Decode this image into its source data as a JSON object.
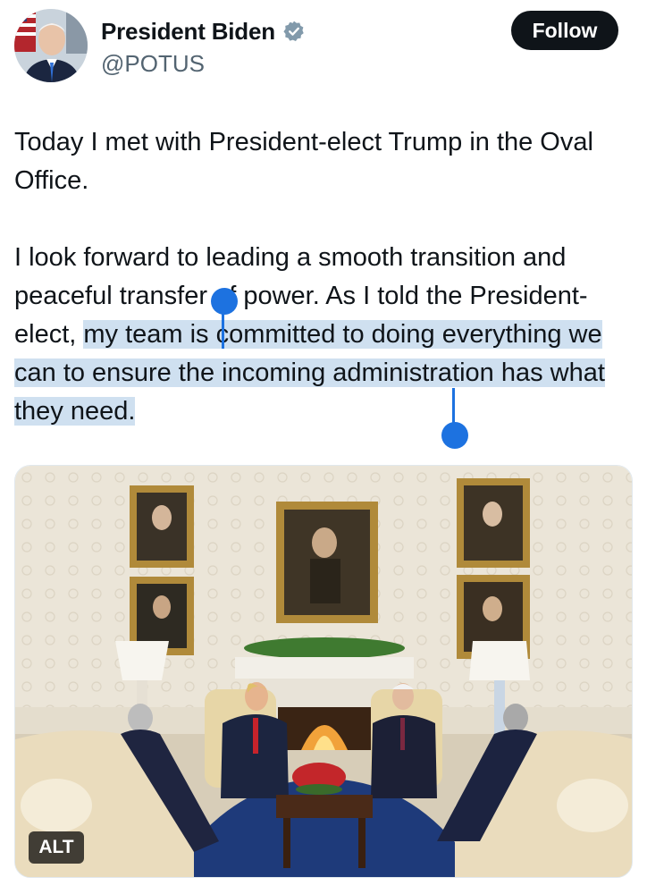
{
  "author": {
    "display_name": "President Biden",
    "handle": "@POTUS",
    "verified": true,
    "avatar_icon": "profile-photo"
  },
  "actions": {
    "follow_label": "Follow"
  },
  "tweet": {
    "paragraph1": "Today I met with President-elect Trump in the Oval Office.",
    "paragraph2_before_selection": "I look forward to leading a smooth transition and peaceful transfer of power. As I told the President-elect, ",
    "paragraph2_selected": "my team is committed to doing everything we can to ensure the incoming administration has what they need."
  },
  "media": {
    "alt_label": "ALT",
    "description_icon": "oval-office-photo"
  },
  "colors": {
    "text": "#0f1419",
    "secondary": "#536471",
    "selection": "#cfe0f0",
    "selection_handle": "#1d72e0",
    "verified_badge": "#829aab"
  }
}
